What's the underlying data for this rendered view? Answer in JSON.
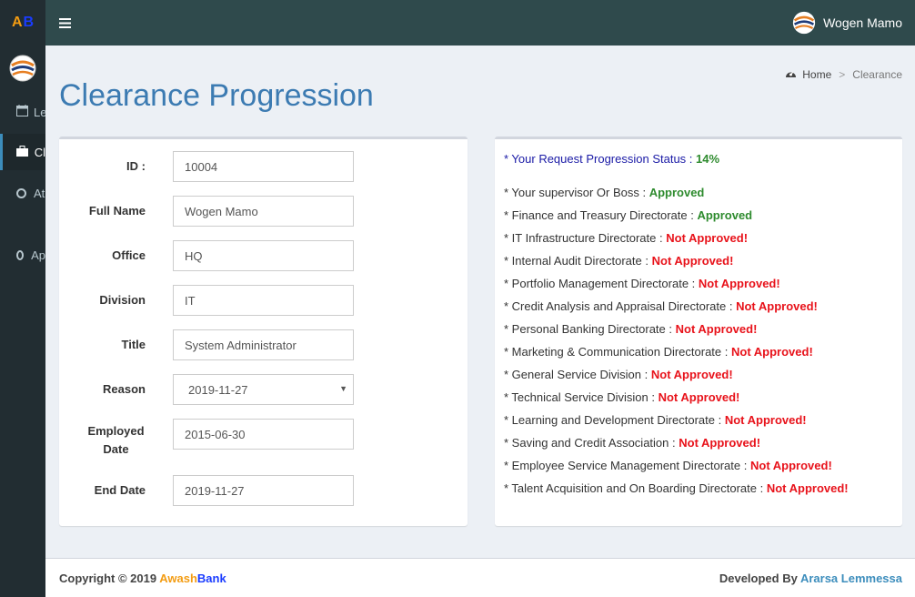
{
  "logo": {
    "a": "A",
    "b": "B"
  },
  "header": {
    "user_name": "Wogen Mamo"
  },
  "sidebar": {
    "items": [
      {
        "label": "Le"
      },
      {
        "label": "Cl"
      },
      {
        "label": "At"
      },
      {
        "label": "Ap"
      }
    ]
  },
  "breadcrumb": {
    "home": "Home",
    "current": "Clearance"
  },
  "page": {
    "title": "Clearance Progression"
  },
  "form": {
    "id_label": "ID :",
    "id_value": "10004",
    "fullname_label": "Full Name",
    "fullname_value": "Wogen Mamo",
    "office_label": "Office",
    "office_value": "HQ",
    "division_label": "Division",
    "division_value": "IT",
    "title_label": "Title",
    "title_value": "System Administrator",
    "reason_label": "Reason",
    "reason_value": "2019-11-27",
    "employed_label_1": "Employed",
    "employed_label_2": "Date",
    "employed_value": "2015-06-30",
    "enddate_label": "End Date",
    "enddate_value": "2019-11-27"
  },
  "status": {
    "head_label": "* Your Request Progression Status :",
    "head_value": "14%",
    "items": [
      {
        "name": "* Your supervisor Or Boss :",
        "state": "Approved"
      },
      {
        "name": "* Finance and Treasury Directorate :",
        "state": "Approved"
      },
      {
        "name": "* IT Infrastructure Directorate :",
        "state": "Not Approved!"
      },
      {
        "name": "* Internal Audit Directorate :",
        "state": "Not Approved!"
      },
      {
        "name": "* Portfolio Management Directorate :",
        "state": "Not Approved!"
      },
      {
        "name": "* Credit Analysis and Appraisal Directorate :",
        "state": "Not Approved!"
      },
      {
        "name": "* Personal Banking Directorate :",
        "state": "Not Approved!"
      },
      {
        "name": "* Marketing & Communication Directorate :",
        "state": "Not Approved!"
      },
      {
        "name": "* General Service Division :",
        "state": "Not Approved!"
      },
      {
        "name": "* Technical Service Division :",
        "state": "Not Approved!"
      },
      {
        "name": "* Learning and Development Directorate :",
        "state": "Not Approved!"
      },
      {
        "name": "* Saving and Credit Association :",
        "state": "Not Approved!"
      },
      {
        "name": "* Employee Service Management Directorate :",
        "state": "Not Approved!"
      },
      {
        "name": "* Talent Acquisition and On Boarding Directorate :",
        "state": "Not Approved!"
      }
    ]
  },
  "footer": {
    "copyright": "Copyright © 2019",
    "brand_a": "Awash",
    "brand_b": "Bank",
    "developed_by": "Developed By",
    "developer": "Ararsa Lemmessa"
  },
  "colors": {
    "header_bg": "#2f4a4c",
    "sidebar_bg": "#222d32",
    "title": "#3c7bb2",
    "approved": "#2e8b2e",
    "not_approved": "#e8121a"
  }
}
